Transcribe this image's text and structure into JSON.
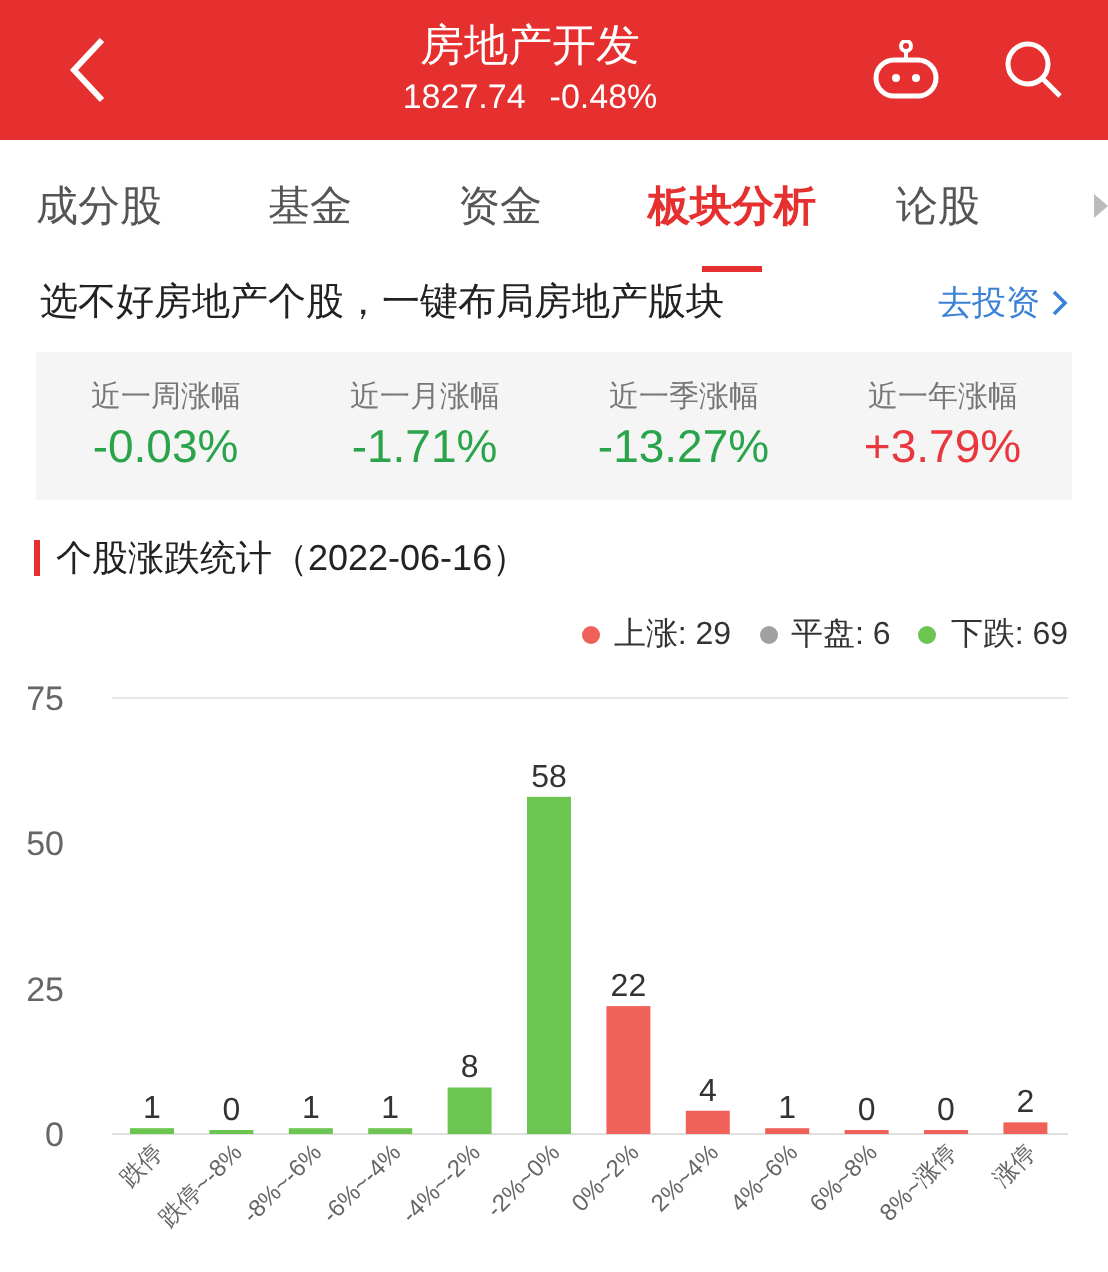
{
  "header": {
    "title": "房地产开发",
    "price": "1827.74",
    "change": "-0.48%"
  },
  "tabs": [
    {
      "label": "成分股",
      "selected": false
    },
    {
      "label": "基金",
      "selected": false
    },
    {
      "label": "资金",
      "selected": false
    },
    {
      "label": "板块分析",
      "selected": true
    },
    {
      "label": "论股",
      "selected": false
    }
  ],
  "promo": {
    "text": "选不好房地产个股，一键布局房地产版块",
    "link": "去投资"
  },
  "stats": [
    {
      "label": "近一周涨幅",
      "value": "-0.03%",
      "color": "#2aa44a"
    },
    {
      "label": "近一月涨幅",
      "value": "-1.71%",
      "color": "#2aa44a"
    },
    {
      "label": "近一季涨幅",
      "value": "-13.27%",
      "color": "#2aa44a"
    },
    {
      "label": "近一年涨幅",
      "value": "+3.79%",
      "color": "#e8383d"
    }
  ],
  "section": {
    "title": "个股涨跌统计（2022-06-16）"
  },
  "legend": [
    {
      "label": "上涨: 29",
      "color": "#f0615a"
    },
    {
      "label": "平盘: 6",
      "color": "#a0a0a0"
    },
    {
      "label": "下跌: 69",
      "color": "#6cc551"
    }
  ],
  "chart_data": {
    "type": "bar",
    "data_labels": true,
    "categories": [
      "跌停",
      "跌停~-8%",
      "-8%~-6%",
      "-6%~-4%",
      "-4%~-2%",
      "-2%~0%",
      "0%~2%",
      "2%~4%",
      "4%~6%",
      "6%~8%",
      "8%~涨停",
      "涨停"
    ],
    "series": [
      {
        "color": "#6cc551",
        "values": [
          1,
          0,
          1,
          1,
          8,
          58,
          null,
          null,
          null,
          null,
          null,
          null
        ]
      },
      {
        "color": "#f0615a",
        "values": [
          null,
          null,
          null,
          null,
          null,
          null,
          22,
          4,
          1,
          0,
          0,
          2
        ]
      }
    ],
    "ylim": [
      0,
      75
    ],
    "yticks": [
      0,
      25,
      50,
      75
    ]
  }
}
